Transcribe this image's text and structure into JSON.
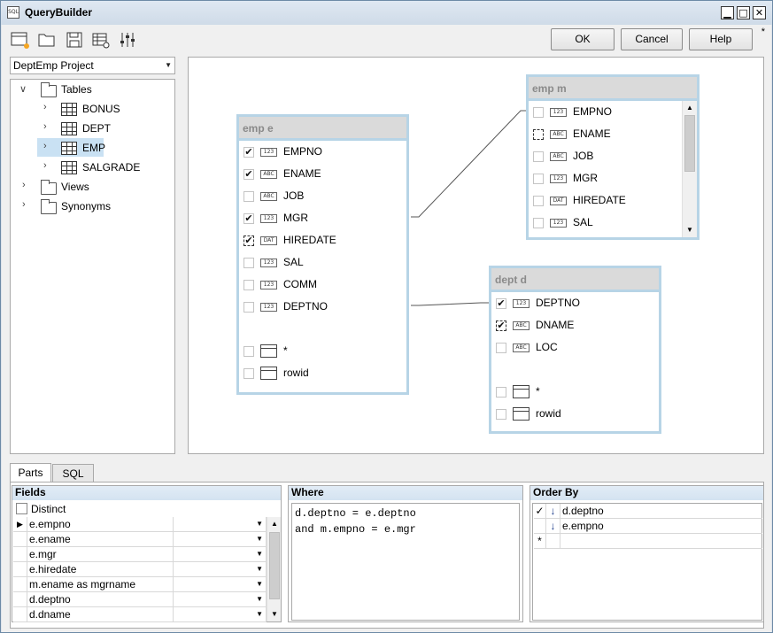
{
  "window": {
    "title": "QueryBuilder",
    "app_icon_text": "SQL",
    "minimize": "▁",
    "maximize": "□",
    "close": "✕",
    "dirty_mark": "*"
  },
  "toolbar": {
    "icons": [
      "new-query-icon",
      "open-folder-icon",
      "save-icon",
      "table-settings-icon",
      "sliders-icon"
    ],
    "ok_label": "OK",
    "cancel_label": "Cancel",
    "help_label": "Help"
  },
  "project": {
    "selected": "DeptEmp Project"
  },
  "tree": {
    "tables": "Tables",
    "items": [
      "BONUS",
      "DEPT",
      "EMP",
      "SALGRADE"
    ],
    "views": "Views",
    "synonyms": "Synonyms"
  },
  "tables": {
    "emp_e": {
      "title": "emp e",
      "fields": [
        {
          "name": "EMPNO",
          "type": "123",
          "checked": true
        },
        {
          "name": "ENAME",
          "type": "ABC",
          "checked": true
        },
        {
          "name": "JOB",
          "type": "ABC",
          "checked": false
        },
        {
          "name": "MGR",
          "type": "123",
          "checked": true
        },
        {
          "name": "HIREDATE",
          "type": "DAT",
          "checked": true
        },
        {
          "name": "SAL",
          "type": "123",
          "checked": false
        },
        {
          "name": "COMM",
          "type": "123",
          "checked": false
        },
        {
          "name": "DEPTNO",
          "type": "123",
          "checked": false
        }
      ],
      "star": "*",
      "rowid": "rowid"
    },
    "emp_m": {
      "title": "emp m",
      "fields": [
        {
          "name": "EMPNO",
          "type": "123",
          "checked": false
        },
        {
          "name": "ENAME",
          "type": "ABC",
          "checked": false
        },
        {
          "name": "JOB",
          "type": "ABC",
          "checked": false
        },
        {
          "name": "MGR",
          "type": "123",
          "checked": false
        },
        {
          "name": "HIREDATE",
          "type": "DAT",
          "checked": false
        },
        {
          "name": "SAL",
          "type": "123",
          "checked": false
        }
      ]
    },
    "dept_d": {
      "title": "dept d",
      "fields": [
        {
          "name": "DEPTNO",
          "type": "123",
          "checked": true
        },
        {
          "name": "DNAME",
          "type": "ABC",
          "checked": true
        },
        {
          "name": "LOC",
          "type": "ABC",
          "checked": false
        }
      ],
      "star": "*",
      "rowid": "rowid"
    }
  },
  "tabs": {
    "parts": "Parts",
    "sql": "SQL"
  },
  "fields_panel": {
    "title": "Fields",
    "distinct_label": "Distinct",
    "rows": [
      "e.empno",
      "e.ename",
      "e.mgr",
      "e.hiredate",
      "m.ename as mgrname",
      "d.deptno",
      "d.dname"
    ]
  },
  "where_panel": {
    "title": "Where",
    "line1": "d.deptno = e.deptno",
    "line2": "and m.empno = e.mgr"
  },
  "orderby_panel": {
    "title": "Order By",
    "rows": [
      "d.deptno",
      "e.empno"
    ],
    "new_row_marker": "*",
    "check_mark": "✓"
  }
}
